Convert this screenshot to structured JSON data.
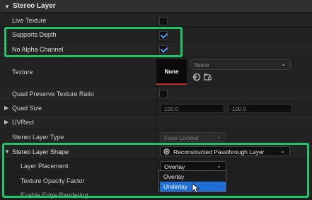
{
  "section": {
    "title": "Stereo Layer",
    "expand_icon": "chevron-down"
  },
  "rows": {
    "live_texture": {
      "label": "Live Texture",
      "checked": false
    },
    "supports_depth": {
      "label": "Supports Depth",
      "checked": true
    },
    "no_alpha_channel": {
      "label": "No Alpha Channel",
      "checked": true
    },
    "texture": {
      "label": "Texture",
      "thumbnail": "None",
      "asset": "None"
    },
    "quad_preserve": {
      "label": "Quad Preserve Texture Ratio",
      "checked": false
    },
    "quad_size": {
      "label": "Quad Size",
      "x": "100.0",
      "y": "100.0"
    },
    "uvrect": {
      "label": "UVRect"
    },
    "stereo_layer_type": {
      "label": "Stereo Layer Type",
      "value": "Face Locked"
    },
    "stereo_layer_shape": {
      "label": "Stereo Layer Shape",
      "value": "Reconstructed Passthrough Layer"
    },
    "layer_placement": {
      "label": "Layer Placement",
      "value": "Overlay"
    },
    "texture_opacity": {
      "label": "Texture Opacity Factor"
    },
    "edge_rendering": {
      "label": "Enable Edge Rendering"
    }
  },
  "dropdown": {
    "options": [
      "Overlay",
      "Underlay"
    ],
    "hovered": "Underlay"
  },
  "colors": {
    "highlight": "#22c46a",
    "accent": "#1f6fd6",
    "check": "#4fa0ff"
  }
}
